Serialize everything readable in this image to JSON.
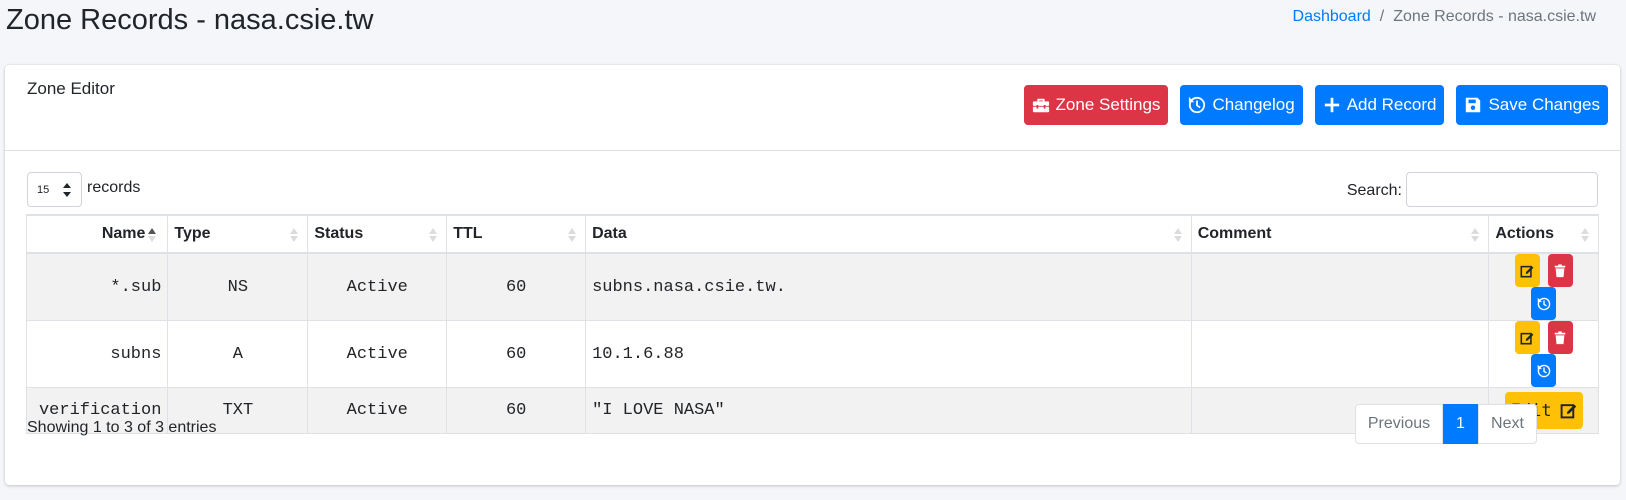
{
  "page": {
    "title": "Zone Records - nasa.csie.tw"
  },
  "breadcrumb": {
    "home": "Dashboard",
    "separator": "/",
    "current": "Zone Records - nasa.csie.tw"
  },
  "card": {
    "title": "Zone Editor"
  },
  "toolbar": {
    "zone_settings": "Zone Settings",
    "changelog": "Changelog",
    "add_record": "Add Record",
    "save_changes": "Save Changes"
  },
  "controls": {
    "page_length": "15",
    "length_label": "records",
    "search_label": "Search:",
    "search_value": ""
  },
  "table": {
    "headers": [
      "Name",
      "Type",
      "Status",
      "TTL",
      "Data",
      "Comment",
      "Actions"
    ],
    "rows": [
      {
        "name": "*.sub",
        "type": "NS",
        "status": "Active",
        "ttl": "60",
        "data": "subns.nasa.csie.tw.",
        "comment": ""
      },
      {
        "name": "subns",
        "type": "A",
        "status": "Active",
        "ttl": "60",
        "data": "10.1.6.88",
        "comment": ""
      },
      {
        "name": "verification",
        "type": "TXT",
        "status": "Active",
        "ttl": "60",
        "data": "\"I LOVE NASA\"",
        "comment": "",
        "edit_label": "Edit"
      }
    ]
  },
  "footer": {
    "info": "Showing 1 to 3 of 3 entries",
    "previous": "Previous",
    "page": "1",
    "next": "Next"
  },
  "colors": {
    "primary": "#007bff",
    "danger": "#dc3545",
    "warning": "#ffc107"
  }
}
